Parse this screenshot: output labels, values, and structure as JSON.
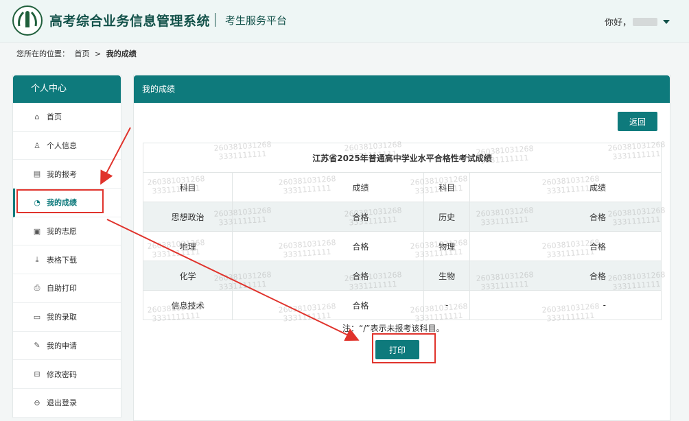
{
  "header": {
    "title": "高考综合业务信息管理系统",
    "subtitle": "考生服务平台",
    "greeting": "你好，"
  },
  "breadcrumb": {
    "prefix": "您所在的位置：",
    "home": "首页",
    "separator": ">",
    "current": "我的成绩"
  },
  "sidebar": {
    "title": "个人中心",
    "items": [
      {
        "label": "首页",
        "icon": "home-icon",
        "glyph": "⌂"
      },
      {
        "label": "个人信息",
        "icon": "user-icon",
        "glyph": "♙"
      },
      {
        "label": "我的报考",
        "icon": "calendar-icon",
        "glyph": "▤"
      },
      {
        "label": "我的成绩",
        "icon": "chart-icon",
        "glyph": "◔"
      },
      {
        "label": "我的志愿",
        "icon": "document-icon",
        "glyph": "▣"
      },
      {
        "label": "表格下载",
        "icon": "download-icon",
        "glyph": "⤓"
      },
      {
        "label": "自助打印",
        "icon": "printer-icon",
        "glyph": "⎙"
      },
      {
        "label": "我的录取",
        "icon": "calendar-check-icon",
        "glyph": "▭"
      },
      {
        "label": "我的申请",
        "icon": "edit-icon",
        "glyph": "✎"
      },
      {
        "label": "修改密码",
        "icon": "lock-icon",
        "glyph": "⊟"
      },
      {
        "label": "退出登录",
        "icon": "logout-icon",
        "glyph": "⊖"
      }
    ],
    "active_index": 3
  },
  "panel": {
    "title": "我的成绩",
    "back_label": "返回",
    "table_caption": "江苏省2025年普通高中学业水平合格性考试成绩",
    "headers": [
      "科目",
      "成绩",
      "科目",
      "成绩"
    ],
    "rows": [
      [
        "思想政治",
        "合格",
        "历史",
        "合格"
      ],
      [
        "地理",
        "合格",
        "物理",
        "合格"
      ],
      [
        "化学",
        "合格",
        "生物",
        "合格"
      ],
      [
        "信息技术",
        "合格",
        "-",
        "-"
      ]
    ],
    "note": "注：“/”表示未报考该科目。",
    "print_label": "打印",
    "watermark_line1": "260381031268",
    "watermark_line2": "3331111111"
  },
  "colors": {
    "accent": "#0e7a7c",
    "highlight": "#e0332c"
  }
}
